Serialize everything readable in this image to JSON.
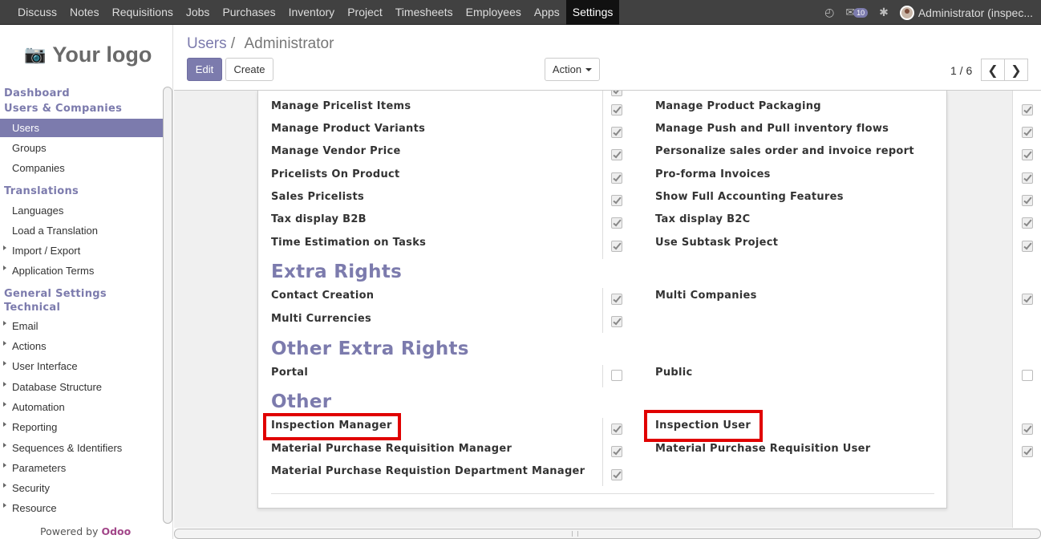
{
  "topnav": {
    "items": [
      "Discuss",
      "Notes",
      "Requisitions",
      "Jobs",
      "Purchases",
      "Inventory",
      "Project",
      "Timesheets",
      "Employees",
      "Apps",
      "Settings"
    ],
    "active": "Settings",
    "message_count": "10",
    "user_label": "Administrator (inspec..."
  },
  "sidebar": {
    "logo_text": "Your logo",
    "dashboard": "Dashboard",
    "users_companies": "Users & Companies",
    "users": "Users",
    "groups": "Groups",
    "companies": "Companies",
    "translations": "Translations",
    "languages": "Languages",
    "load_translation": "Load a Translation",
    "import_export": "Import / Export",
    "application_terms": "Application Terms",
    "general_settings": "General Settings",
    "technical": "Technical",
    "email": "Email",
    "actions": "Actions",
    "user_interface": "User Interface",
    "database_structure": "Database Structure",
    "automation": "Automation",
    "reporting": "Reporting",
    "sequences": "Sequences & Identifiers",
    "parameters": "Parameters",
    "security": "Security",
    "resource": "Resource",
    "powered_by": "Powered by",
    "powered_brand": "Odoo"
  },
  "header": {
    "breadcrumb_link": "Users",
    "breadcrumb_sep": "/",
    "breadcrumb_current": "Administrator",
    "edit_label": "Edit",
    "create_label": "Create",
    "action_label": "Action",
    "pager": "1 / 6"
  },
  "form": {
    "rows_top": [
      {
        "left": "Manage Pricelist Items",
        "right": "Manage Product Packaging"
      },
      {
        "left": "Manage Product Variants",
        "right": "Manage Push and Pull inventory flows"
      },
      {
        "left": "Manage Vendor Price",
        "right": "Personalize sales order and invoice report"
      },
      {
        "left": "Pricelists On Product",
        "right": "Pro-forma Invoices"
      },
      {
        "left": "Sales Pricelists",
        "right": "Show Full Accounting Features"
      },
      {
        "left": "Tax display B2B",
        "right": "Tax display B2C"
      },
      {
        "left": "Time Estimation on Tasks",
        "right": "Use Subtask Project"
      }
    ],
    "extra_rights_title": "Extra Rights",
    "extra_rights": {
      "contact_creation": "Contact Creation",
      "multi_companies": "Multi Companies",
      "multi_currencies": "Multi Currencies"
    },
    "other_extra_rights_title": "Other Extra Rights",
    "other_extra_rights": {
      "portal": "Portal",
      "public": "Public"
    },
    "other_title": "Other",
    "other": {
      "inspection_manager": "Inspection Manager",
      "inspection_user": "Inspection User",
      "mpr_manager": "Material Purchase Requisition Manager",
      "mpr_user": "Material Purchase Requisition User",
      "mpr_dept_manager": "Material Purchase Requistion Department Manager"
    }
  },
  "colors": {
    "accent": "#7c7bad",
    "highlight": "#e00000",
    "topbar": "#414141"
  }
}
